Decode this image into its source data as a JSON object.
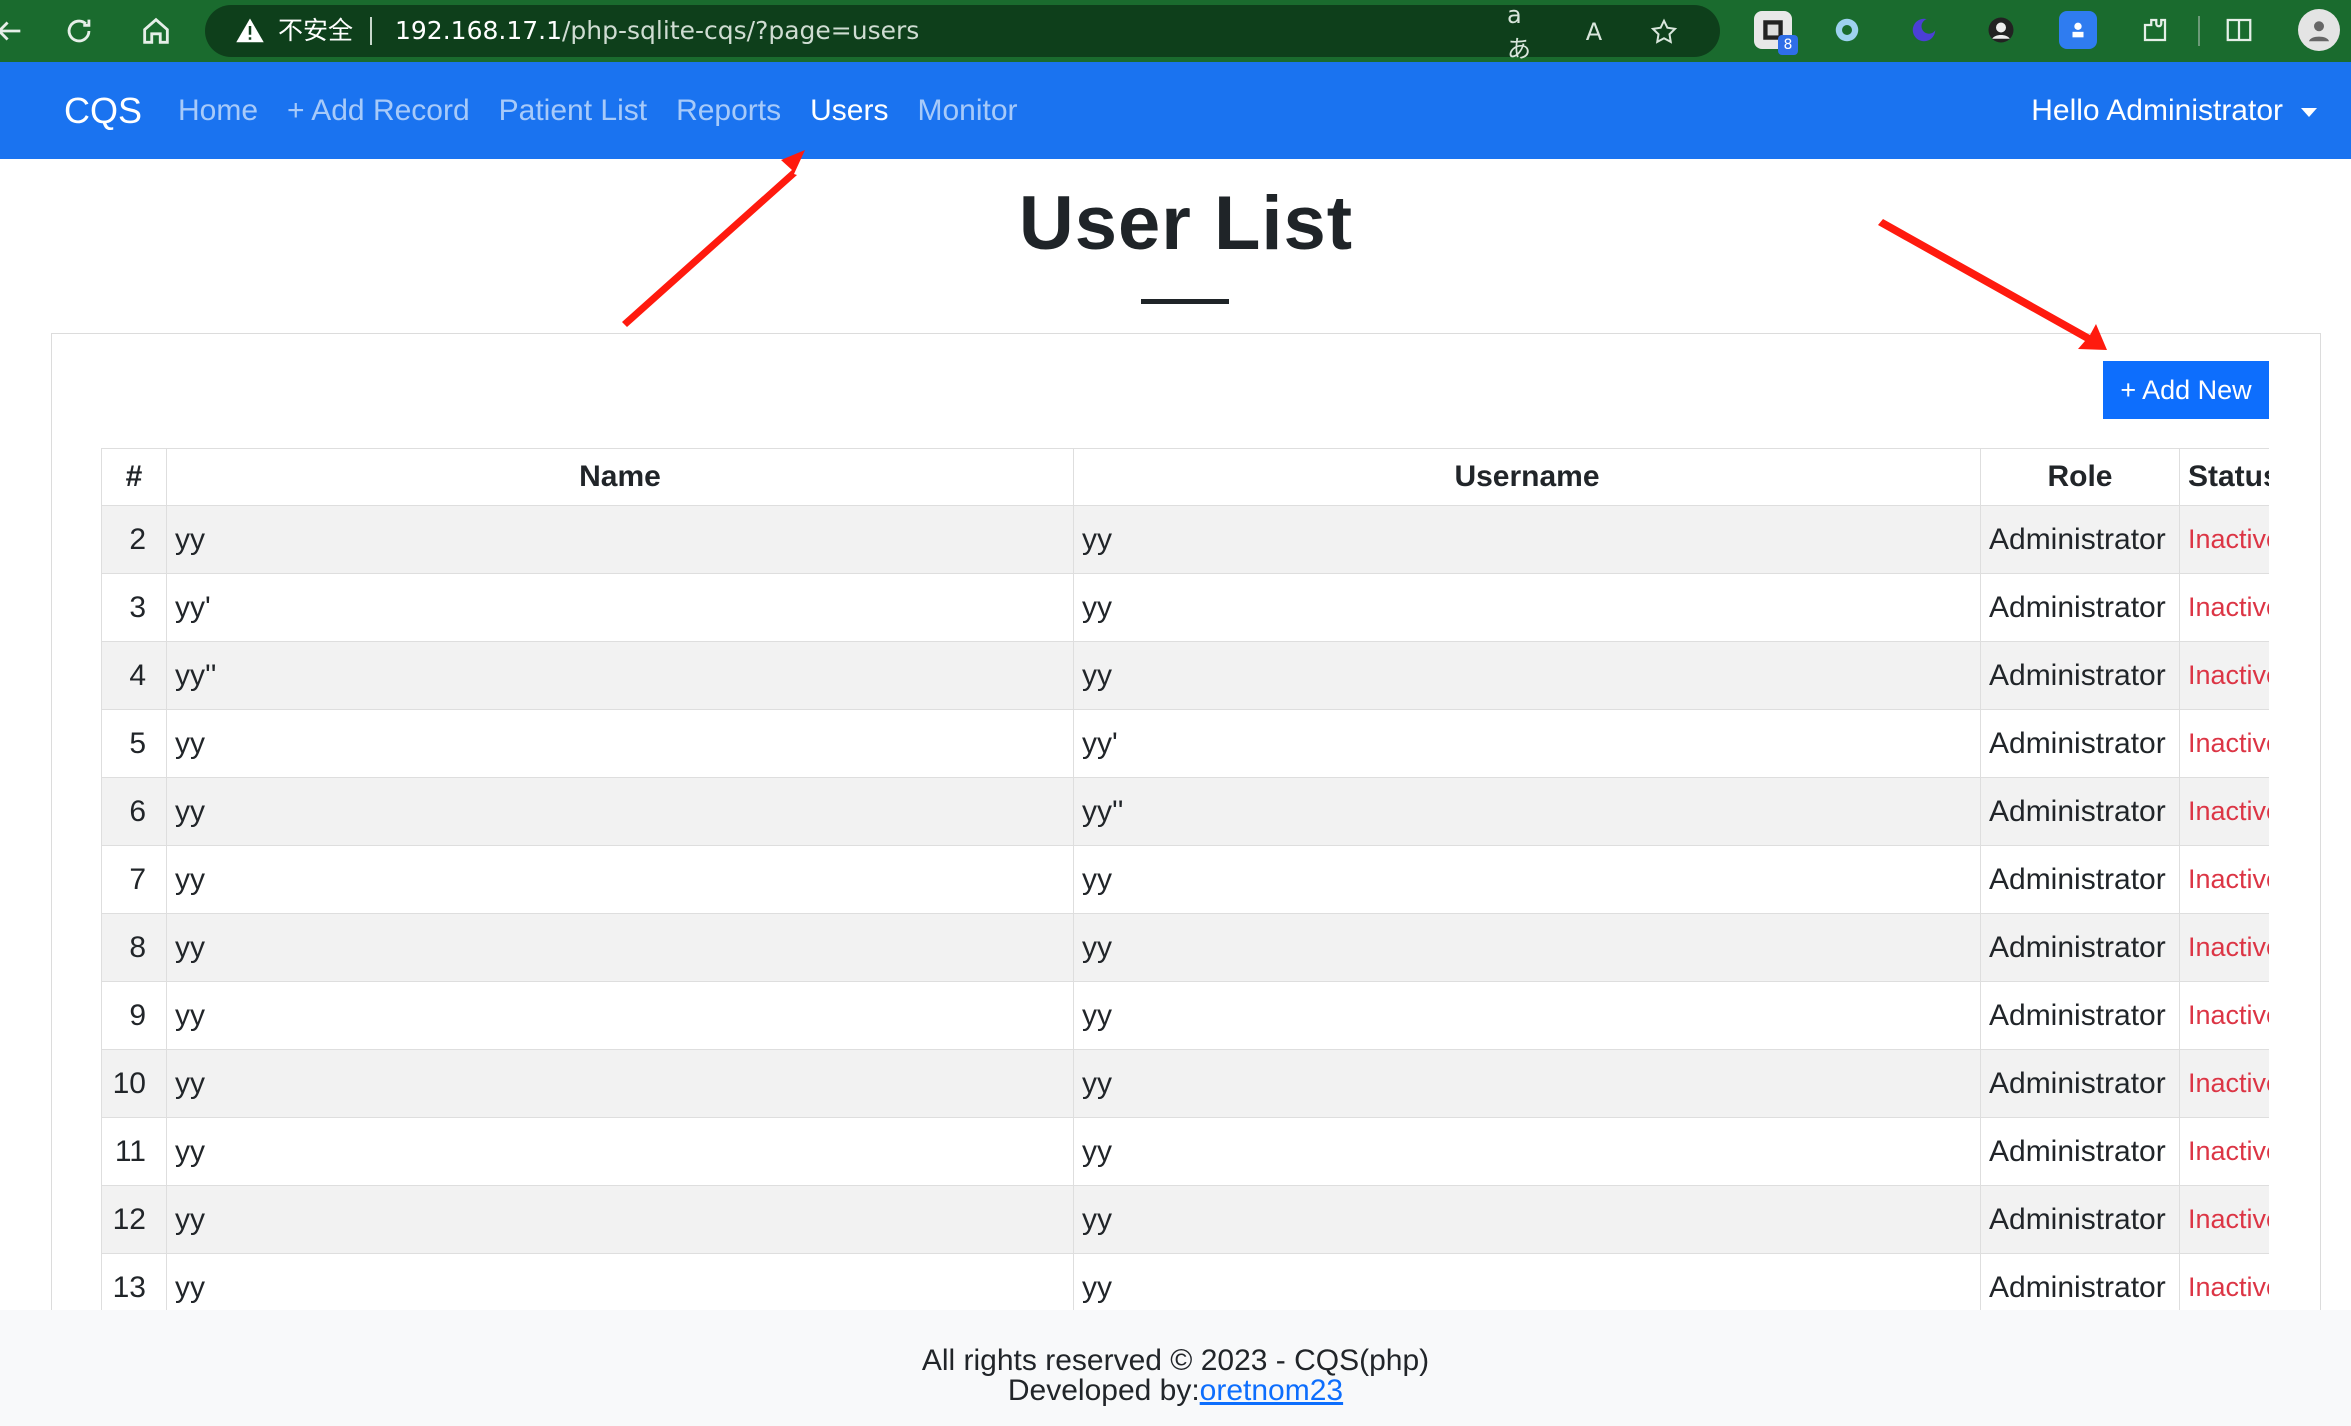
{
  "browser": {
    "security_label": "不安全",
    "url_host": "192.168.17.1",
    "url_path": "/php-sqlite-cqs/?page=users",
    "read_aloud_label": "A",
    "translate_label": "aあ",
    "extension_badge": "8"
  },
  "navbar": {
    "brand": "CQS",
    "links": [
      "Home",
      "+ Add Record",
      "Patient List",
      "Reports",
      "Users",
      "Monitor"
    ],
    "active": "Users",
    "user_greeting": "Hello Administrator"
  },
  "page": {
    "title": "User List",
    "add_new_label": "+ Add New"
  },
  "table": {
    "columns": [
      "#",
      "Name",
      "Username",
      "Role",
      "Status"
    ],
    "rows": [
      {
        "num": "2",
        "name": "yy",
        "username": "yy",
        "role": "Administrator",
        "status": "Inactive"
      },
      {
        "num": "3",
        "name": "yy'",
        "username": "yy",
        "role": "Administrator",
        "status": "Inactive"
      },
      {
        "num": "4",
        "name": "yy''",
        "username": "yy",
        "role": "Administrator",
        "status": "Inactive"
      },
      {
        "num": "5",
        "name": "yy",
        "username": "yy'",
        "role": "Administrator",
        "status": "Inactive"
      },
      {
        "num": "6",
        "name": "yy",
        "username": "yy''",
        "role": "Administrator",
        "status": "Inactive"
      },
      {
        "num": "7",
        "name": "yy",
        "username": "yy",
        "role": "Administrator",
        "status": "Inactive"
      },
      {
        "num": "8",
        "name": "yy",
        "username": "yy",
        "role": "Administrator",
        "status": "Inactive"
      },
      {
        "num": "9",
        "name": "yy",
        "username": "yy",
        "role": "Administrator",
        "status": "Inactive"
      },
      {
        "num": "10",
        "name": "yy",
        "username": "yy",
        "role": "Administrator",
        "status": "Inactive"
      },
      {
        "num": "11",
        "name": "yy",
        "username": "yy",
        "role": "Administrator",
        "status": "Inactive"
      },
      {
        "num": "12",
        "name": "yy",
        "username": "yy",
        "role": "Administrator",
        "status": "Inactive"
      },
      {
        "num": "13",
        "name": "yy",
        "username": "yy",
        "role": "Administrator",
        "status": "Inactive"
      }
    ]
  },
  "footer": {
    "copyright": "All rights reserved © 2023 - CQS(php)",
    "developed_by": "Developed by:",
    "developer": "oretnom23"
  },
  "colors": {
    "navbar": "#1a73f0",
    "primary_button": "#0d6efd",
    "status_inactive": "#dc3545",
    "annotation_arrow": "#ff1a0e"
  }
}
